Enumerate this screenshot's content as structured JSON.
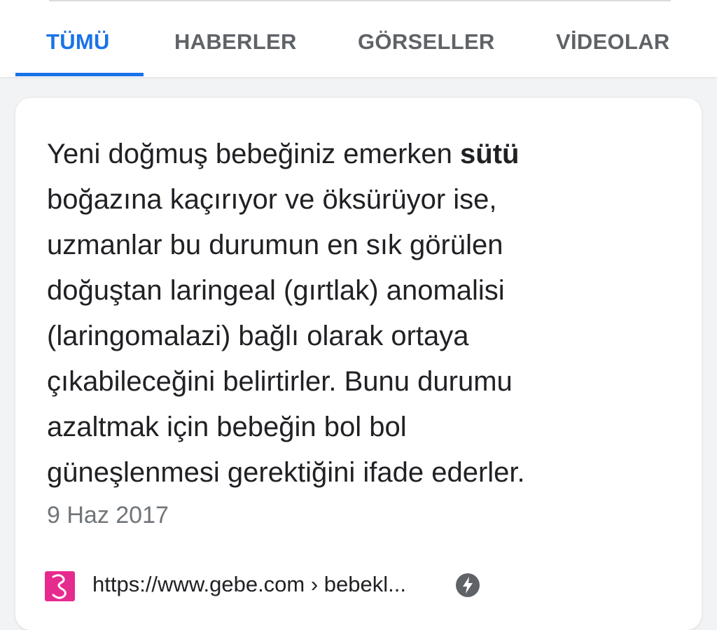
{
  "tabs": [
    {
      "label": "TÜMÜ",
      "active": true
    },
    {
      "label": "HABERLER",
      "active": false
    },
    {
      "label": "GÖRSELLER",
      "active": false
    },
    {
      "label": "VİDEOLAR",
      "active": false
    }
  ],
  "result": {
    "snippet": {
      "line1_before": "Yeni doğmuş bebeğiniz emerken ",
      "line1_bold": "sütü",
      "line2": "boğazına kaçırıyor ve öksürüyor ise,",
      "line3": "uzmanlar bu durumun en sık görülen",
      "line4": "doğuştan laringeal (gırtlak) anomalisi",
      "line5": "(laringomalazi) bağlı olarak ortaya",
      "line6": "çıkabileceğini belirtirler. Bunu durumu",
      "line7": "azaltmak için bebeğin bol bol",
      "line8": "güneşlenmesi gerektiğini ifade ederler."
    },
    "date": "9 Haz 2017",
    "source": {
      "url": "https://www.gebe.com › bebekl...",
      "favicon_icon": "gebe-logo-icon",
      "amp_icon": "amp-bolt-icon"
    }
  },
  "colors": {
    "accent": "#1a73e8",
    "favicon": "#e62b8e"
  }
}
